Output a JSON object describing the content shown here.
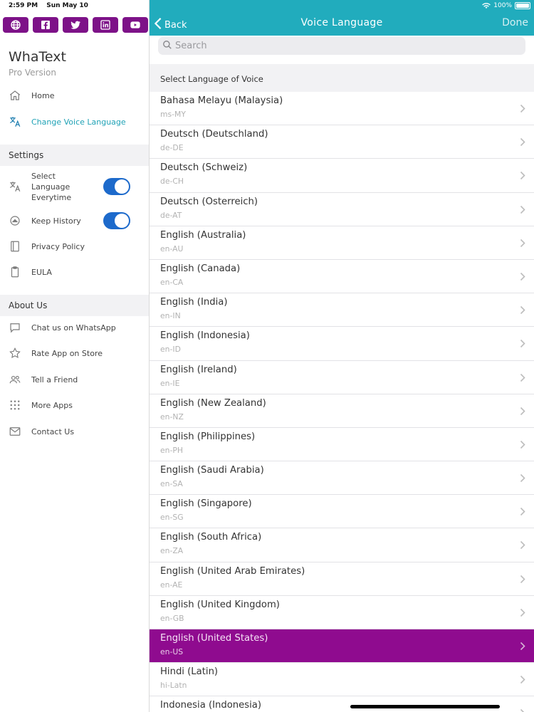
{
  "status_bar": {
    "time": "2:59 PM",
    "date": "Sun May 10",
    "battery": "100%"
  },
  "social": [
    {
      "icon": "globe-icon"
    },
    {
      "icon": "facebook-icon"
    },
    {
      "icon": "twitter-icon"
    },
    {
      "icon": "linkedin-icon"
    },
    {
      "icon": "youtube-icon"
    }
  ],
  "sidebar": {
    "app_title": "WhaText",
    "app_subtitle": "Pro Version",
    "nav": [
      {
        "label": "Home",
        "icon": "home-icon"
      },
      {
        "label": "Change Voice Language",
        "icon": "translate-icon",
        "active": true
      }
    ],
    "settings_header": "Settings",
    "settings": [
      {
        "label": "Select Language Everytime",
        "icon": "translate-icon",
        "toggle": true
      },
      {
        "label": "Keep History",
        "icon": "history-icon",
        "toggle": true
      },
      {
        "label": "Privacy Policy",
        "icon": "book-icon"
      },
      {
        "label": "EULA",
        "icon": "clipboard-icon"
      }
    ],
    "about_header": "About Us",
    "about": [
      {
        "label": "Chat us on WhatsApp",
        "icon": "chat-icon"
      },
      {
        "label": "Rate App on Store",
        "icon": "star-icon"
      },
      {
        "label": "Tell a Friend",
        "icon": "people-icon"
      },
      {
        "label": "More Apps",
        "icon": "grid-icon"
      },
      {
        "label": "Contact Us",
        "icon": "mail-icon"
      }
    ]
  },
  "navbar": {
    "back_label": "Back",
    "title": "Voice Language",
    "done_label": "Done"
  },
  "search": {
    "placeholder": "Search",
    "value": ""
  },
  "list": {
    "header": "Select Language of Voice",
    "items": [
      {
        "name": "Bahasa Melayu (Malaysia)",
        "code": "ms-MY"
      },
      {
        "name": "Deutsch (Deutschland)",
        "code": "de-DE"
      },
      {
        "name": "Deutsch (Schweiz)",
        "code": "de-CH"
      },
      {
        "name": "Deutsch (Osterreich)",
        "code": "de-AT"
      },
      {
        "name": "English (Australia)",
        "code": "en-AU"
      },
      {
        "name": "English (Canada)",
        "code": "en-CA"
      },
      {
        "name": "English (India)",
        "code": "en-IN"
      },
      {
        "name": "English (Indonesia)",
        "code": "en-ID"
      },
      {
        "name": "English (Ireland)",
        "code": "en-IE"
      },
      {
        "name": "English (New Zealand)",
        "code": "en-NZ"
      },
      {
        "name": "English (Philippines)",
        "code": "en-PH"
      },
      {
        "name": "English (Saudi Arabia)",
        "code": "en-SA"
      },
      {
        "name": "English (Singapore)",
        "code": "en-SG"
      },
      {
        "name": "English (South Africa)",
        "code": "en-ZA"
      },
      {
        "name": "English (United Arab Emirates)",
        "code": "en-AE"
      },
      {
        "name": "English (United Kingdom)",
        "code": "en-GB"
      },
      {
        "name": "English (United States)",
        "code": "en-US",
        "selected": true
      },
      {
        "name": "Hindi (Latin)",
        "code": "hi-Latn"
      },
      {
        "name": "Indonesia (Indonesia)",
        "code": ""
      }
    ]
  },
  "colors": {
    "accent": "#21acbd",
    "social_purple": "#7d1288",
    "selected_row": "#8f0b8f",
    "toggle_on": "#1d6acb",
    "active_link": "#20a2b6"
  }
}
